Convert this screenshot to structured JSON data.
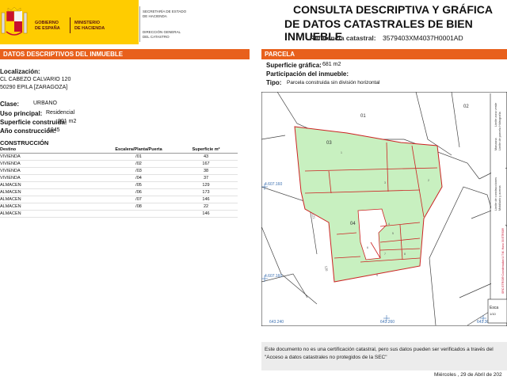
{
  "header": {
    "gov_line1": "Gobierno",
    "gov_line2": "de España",
    "min_line1": "Ministerio",
    "min_line2": "de Hacienda",
    "sec_line1": "Secretaría de Estado",
    "sec_line2": "de Hacienda",
    "dir_line1": "Dirección General",
    "dir_line2": "del Catastro",
    "title_line1": "CONSULTA DESCRIPTIVA Y GRÁFICA",
    "title_line2": "DE DATOS CATASTRALES DE BIEN INMUEBLE",
    "ref_label": "Referencia catastral:",
    "ref_value": "3579403XM4037H0001AD",
    "brand_color": "#ffcc00",
    "accent_color": "#e8601c"
  },
  "left": {
    "section_title": "DATOS DESCRIPTIVOS DEL INMUEBLE",
    "localizacion_label": "Localización:",
    "address_line1": "CL CABEZO CALVARIO 120",
    "address_line2": "50290 EPILA [ZARAGOZA]",
    "clase_label": "Clase:",
    "clase_value": "URBANO",
    "uso_label": "Uso principal:",
    "uso_value": "Residencial",
    "superficie_label": "Superficie construida:",
    "superficie_value": "901 m2",
    "ano_label": "Año construcción:",
    "ano_value": "1945",
    "construccion_title": "CONSTRUCCIÓN",
    "table_headers": [
      "Destino",
      "Escalera/Planta/Puerta",
      "Superficie m²"
    ],
    "table_rows": [
      [
        "VIVIENDA",
        "/01",
        "43"
      ],
      [
        "VIVIENDA",
        "/02",
        "167"
      ],
      [
        "VIVIENDA",
        "/03",
        "38"
      ],
      [
        "VIVIENDA",
        "/04",
        "37"
      ],
      [
        "ALMACEN",
        "/05",
        "129"
      ],
      [
        "ALMACEN",
        "/06",
        "173"
      ],
      [
        "ALMACEN",
        "/07",
        "146"
      ],
      [
        "ALMACEN",
        "/08",
        "22"
      ],
      [
        "ALMACEN",
        "",
        "146"
      ]
    ]
  },
  "right": {
    "section_title": "PARCELA",
    "supg_label": "Superficie gráfica:",
    "supg_value": "681 m2",
    "part_label": "Participación del inmueble:",
    "tipo_label": "Tipo:",
    "tipo_value": "Parcela construida sin división horizontal",
    "map": {
      "parcel_fill": "#c8f0c0",
      "line_color": "#cc2222",
      "labels": [
        "01",
        "02",
        "03",
        "04",
        "4.607.160",
        "4.607.160",
        "643.240",
        "643.260",
        "643.300",
        "Esca",
        "1/10"
      ],
      "parcel_numbers": [
        "1",
        "2",
        "3",
        "4",
        "5",
        "6",
        "7",
        "8",
        "9"
      ],
      "legend_items": [
        "Manzana",
        "Límite de parcela",
        "Límite de construcciones",
        "Mobiliario y aceras",
        "Límite zona verde",
        "Hidrografía"
      ],
      "side_text": "SRC ETRS89 Coordenadas U.T.M. Huso 30 ETRS89"
    }
  },
  "footer": {
    "notice": "Este documento no es una certificación catastral, pero sus datos pueden ser verificados a través del \"Acceso a datos catastrales no protegidos de la SEC\"",
    "date": "Miércoles , 29 de Abril de 202"
  }
}
